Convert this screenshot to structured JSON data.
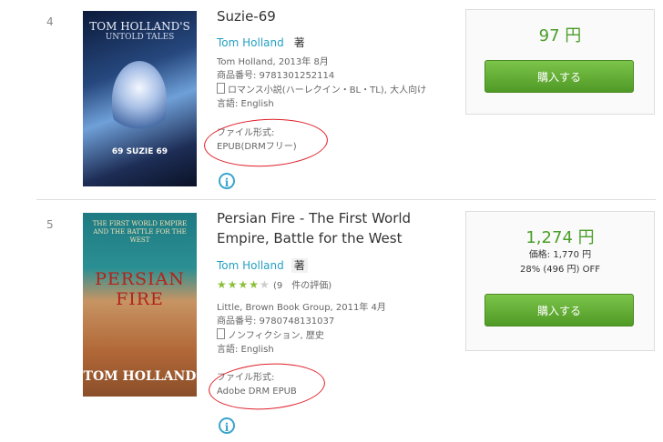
{
  "items": [
    {
      "rank": "4",
      "title": "Suzie-69",
      "author": "Tom Holland",
      "author_suffix": "著",
      "publisher_line": "Tom Holland, 2013年 8月",
      "isbn": "商品番号: 9781301252114",
      "genre": "ロマンス小説(ハーレクイン・BL・TL), 大人向け",
      "language": "言語: English",
      "format_label": "ファイル形式:",
      "format": "EPUB(DRMフリー)",
      "cover_top": "TOM HOLLAND'S",
      "cover_mid": "UNTOLD TALES",
      "cover_bottom": "69 SUZIE 69",
      "price": "97 円",
      "buy_label": "購入する"
    },
    {
      "rank": "5",
      "title_line1": "Persian Fire - The First World",
      "title_line2": "Empire, Battle for the West",
      "author": "Tom Holland",
      "author_suffix": "著",
      "rating_stars": 4,
      "rating_text": "(9　件の評価)",
      "publisher_line": "Little, Brown Book Group, 2011年 4月",
      "isbn": "商品番号: 9780748131037",
      "genre": "ノンフィクション, 歴史",
      "language": "言語: English",
      "format_label": "ファイル形式:",
      "format": "Adobe DRM EPUB",
      "cover_top": "THE FIRST WORLD EMPIRE AND THE BATTLE FOR THE WEST",
      "cover_title": "PERSIAN FIRE",
      "cover_author": "TOM HOLLAND",
      "price": "1,274 円",
      "list_price": "価格: 1,770 円",
      "discount": "28% (496 円) OFF",
      "buy_label": "購入する"
    }
  ],
  "colors": {
    "accent_green": "#4a9e28",
    "link_blue": "#26a0c2",
    "annotation_red": "#e0202a"
  }
}
